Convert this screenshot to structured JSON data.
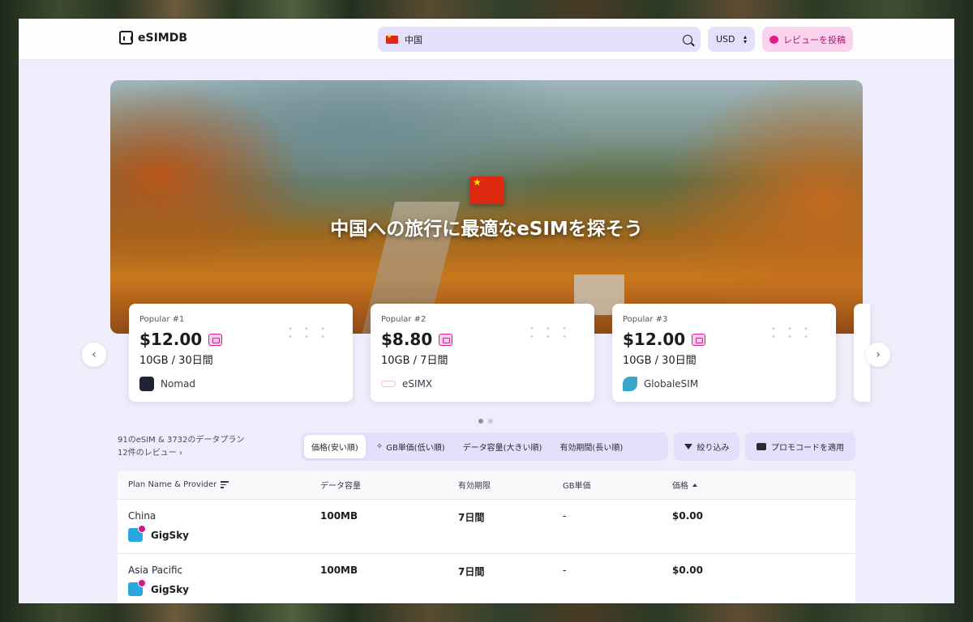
{
  "header": {
    "logo_text": "eSIMDB",
    "search_value": "中国",
    "currency": "USD",
    "review_button": "レビューを投稿"
  },
  "hero": {
    "title": "中国への旅行に最適なeSIMを探そう"
  },
  "cards": [
    {
      "rank": "Popular #1",
      "price": "$12.00",
      "plan": "10GB / 30日間",
      "provider": "Nomad"
    },
    {
      "rank": "Popular #2",
      "price": "$8.80",
      "plan": "10GB / 7日間",
      "provider": "eSIMX"
    },
    {
      "rank": "Popular #3",
      "price": "$12.00",
      "plan": "10GB / 30日間",
      "provider": "GlobaleSIM"
    }
  ],
  "stats": {
    "counts": "91のeSIM & 3732のデータプラン",
    "reviews": "12件のレビュー"
  },
  "tabs": [
    {
      "label": "価格(安い順)"
    },
    {
      "label": "GB単価(低い順)"
    },
    {
      "label": "データ容量(大きい順)"
    },
    {
      "label": "有効期間(長い順)"
    }
  ],
  "filters": {
    "filter_label": "絞り込み",
    "promo_label": "プロモコードを適用"
  },
  "table": {
    "headers": [
      "Plan Name & Provider",
      "データ容量",
      "有効期限",
      "GB単価",
      "価格"
    ],
    "rows": [
      {
        "plan": "China",
        "provider": "GigSky",
        "data": "100MB",
        "validity": "7日間",
        "per_gb": "-",
        "price": "$0.00"
      },
      {
        "plan": "Asia Pacific",
        "provider": "GigSky",
        "data": "100MB",
        "validity": "7日間",
        "per_gb": "-",
        "price": "$0.00"
      }
    ]
  },
  "colors": {
    "accent_bg": "#e4e0fb",
    "review_bg": "#fcd3ee",
    "brand_pink": "#e31b8c",
    "flag_red": "#de2910"
  }
}
